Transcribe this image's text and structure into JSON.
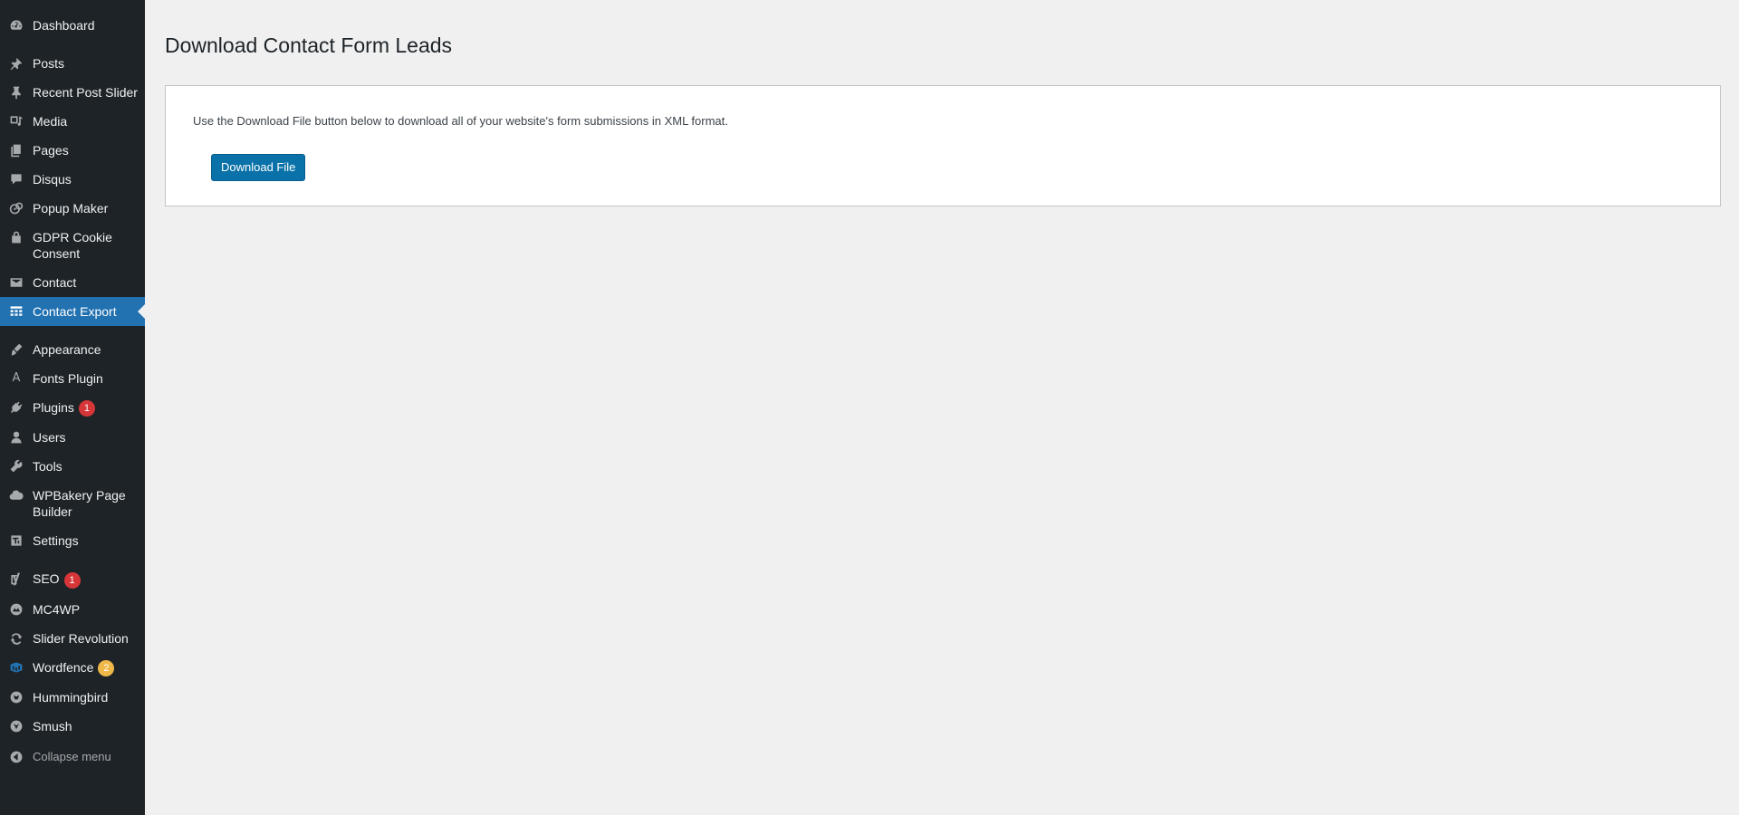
{
  "sidebar": {
    "items": [
      {
        "name": "dashboard",
        "label": "Dashboard",
        "icon": "dashboard-icon"
      },
      {
        "name": "posts",
        "label": "Posts",
        "icon": "pin-icon"
      },
      {
        "name": "recent-post-slider",
        "label": "Recent Post Slider",
        "icon": "pushpin-icon"
      },
      {
        "name": "media",
        "label": "Media",
        "icon": "media-icon"
      },
      {
        "name": "pages",
        "label": "Pages",
        "icon": "pages-icon"
      },
      {
        "name": "disqus",
        "label": "Disqus",
        "icon": "comment-icon"
      },
      {
        "name": "popup-maker",
        "label": "Popup Maker",
        "icon": "popup-maker-icon"
      },
      {
        "name": "gdpr-cookie-consent",
        "label": "GDPR Cookie Consent",
        "icon": "lock-icon"
      },
      {
        "name": "contact",
        "label": "Contact",
        "icon": "mail-icon"
      },
      {
        "name": "contact-export",
        "label": "Contact Export",
        "icon": "table-icon"
      },
      {
        "name": "appearance",
        "label": "Appearance",
        "icon": "brush-icon"
      },
      {
        "name": "fonts-plugin",
        "label": "Fonts Plugin",
        "icon": "font-icon"
      },
      {
        "name": "plugins",
        "label": "Plugins",
        "icon": "plugin-icon",
        "badge": "1"
      },
      {
        "name": "users",
        "label": "Users",
        "icon": "user-icon"
      },
      {
        "name": "tools",
        "label": "Tools",
        "icon": "wrench-icon"
      },
      {
        "name": "wpbakery",
        "label": "WPBakery Page Builder",
        "icon": "cloud-icon"
      },
      {
        "name": "settings",
        "label": "Settings",
        "icon": "settings-icon"
      },
      {
        "name": "seo",
        "label": "SEO",
        "icon": "yoast-icon",
        "badge": "1"
      },
      {
        "name": "mc4wp",
        "label": "MC4WP",
        "icon": "mc4wp-icon"
      },
      {
        "name": "slider-revolution",
        "label": "Slider Revolution",
        "icon": "refresh-icon"
      },
      {
        "name": "wordfence",
        "label": "Wordfence",
        "icon": "wordfence-icon",
        "badge": "2"
      },
      {
        "name": "hummingbird",
        "label": "Hummingbird",
        "icon": "hummingbird-icon"
      },
      {
        "name": "smush",
        "label": "Smush",
        "icon": "smush-icon"
      }
    ],
    "collapse_label": "Collapse menu",
    "active_item": "Contact Export"
  },
  "main": {
    "title": "Download Contact Form Leads",
    "description": "Use the Download File button below to download all of your website's form submissions in XML format.",
    "download_button_label": "Download File"
  },
  "colors": {
    "sidebar_bg": "#1d2327",
    "active_bg": "#2271b1",
    "button_bg": "#0a72a8",
    "badge_red": "#d63638",
    "badge_orange": "#f0b849",
    "page_bg": "#f0f0f1"
  }
}
